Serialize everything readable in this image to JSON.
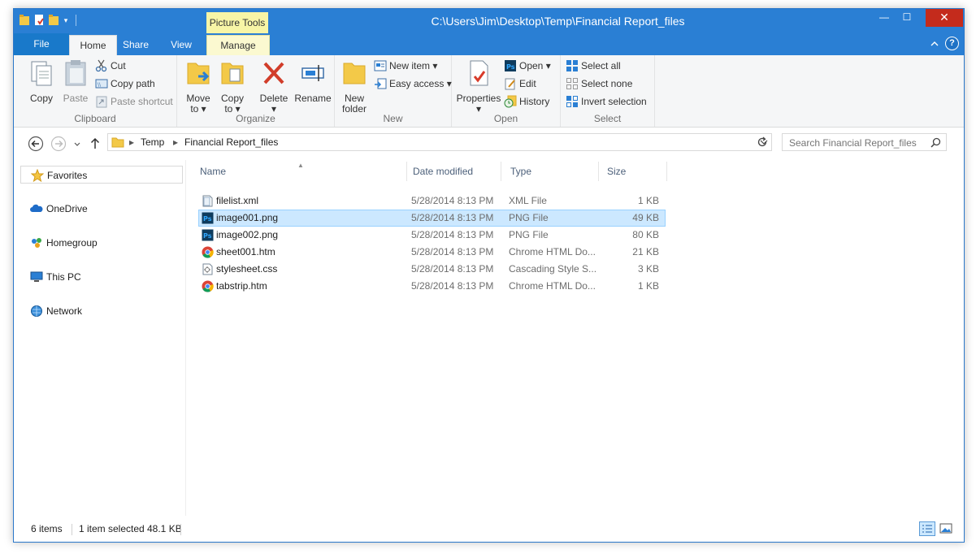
{
  "window": {
    "title": "C:\\Users\\Jim\\Desktop\\Temp\\Financial Report_files",
    "contextual_tab_header": "Picture Tools",
    "controls": {
      "minimize": "—",
      "maximize": "☐",
      "close": "✕"
    }
  },
  "ribbon_tabs": {
    "file": "File",
    "home": "Home",
    "share": "Share",
    "view": "View",
    "manage": "Manage",
    "help": "?"
  },
  "ribbon": {
    "clipboard": {
      "label": "Clipboard",
      "copy": "Copy",
      "paste": "Paste",
      "cut": "Cut",
      "copy_path": "Copy path",
      "paste_shortcut": "Paste shortcut"
    },
    "organize": {
      "label": "Organize",
      "move_to_1": "Move",
      "move_to_2": "to ▾",
      "copy_to_1": "Copy",
      "copy_to_2": "to ▾",
      "delete": "Delete",
      "delete_arrow": "▾",
      "rename": "Rename"
    },
    "new": {
      "label": "New",
      "new_folder_1": "New",
      "new_folder_2": "folder",
      "new_item": "New item ▾",
      "easy_access": "Easy access ▾"
    },
    "open": {
      "label": "Open",
      "properties": "Properties",
      "properties_arrow": "▾",
      "open": "Open ▾",
      "edit": "Edit",
      "history": "History"
    },
    "select": {
      "label": "Select",
      "select_all": "Select all",
      "select_none": "Select none",
      "invert_selection": "Invert selection"
    }
  },
  "address": {
    "breadcrumbs": [
      "Temp",
      "Financial Report_files"
    ],
    "search_placeholder": "Search Financial Report_files"
  },
  "nav": {
    "favorites": "Favorites",
    "onedrive": "OneDrive",
    "homegroup": "Homegroup",
    "this_pc": "This PC",
    "network": "Network"
  },
  "columns": {
    "name": "Name",
    "date": "Date modified",
    "type": "Type",
    "size": "Size"
  },
  "files": [
    {
      "name": "filelist.xml",
      "date": "5/28/2014 8:13 PM",
      "type": "XML File",
      "size": "1 KB",
      "icon": "xml-file-icon"
    },
    {
      "name": "image001.png",
      "date": "5/28/2014 8:13 PM",
      "type": "PNG File",
      "size": "49 KB",
      "icon": "photoshop-file-icon",
      "selected": true
    },
    {
      "name": "image002.png",
      "date": "5/28/2014 8:13 PM",
      "type": "PNG File",
      "size": "80 KB",
      "icon": "photoshop-file-icon"
    },
    {
      "name": "sheet001.htm",
      "date": "5/28/2014 8:13 PM",
      "type": "Chrome HTML Do...",
      "size": "21 KB",
      "icon": "chrome-file-icon"
    },
    {
      "name": "stylesheet.css",
      "date": "5/28/2014 8:13 PM",
      "type": "Cascading Style S...",
      "size": "3 KB",
      "icon": "css-file-icon"
    },
    {
      "name": "tabstrip.htm",
      "date": "5/28/2014 8:13 PM",
      "type": "Chrome HTML Do...",
      "size": "1 KB",
      "icon": "chrome-file-icon"
    }
  ],
  "status": {
    "items": "6 items",
    "selected": "1 item selected",
    "size": "48.1 KB"
  },
  "colors": {
    "accent": "#2a7fd4",
    "selection": "#cce8ff",
    "close": "#c42b1c",
    "picture_tools": "#f7f5a6"
  }
}
